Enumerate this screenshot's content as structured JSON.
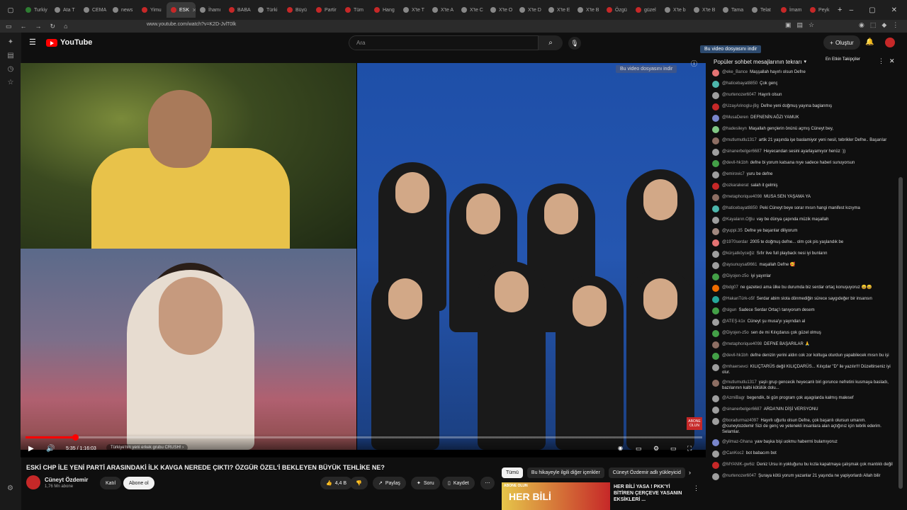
{
  "browser": {
    "tabs": [
      {
        "label": "Turkiy",
        "color": "#2e7d32"
      },
      {
        "label": "Ata T",
        "color": "#888"
      },
      {
        "label": "CEMA",
        "color": "#888"
      },
      {
        "label": "news",
        "color": "#888"
      },
      {
        "label": "Yimu",
        "color": "#c62828"
      },
      {
        "label": "ESK",
        "color": "#c62828",
        "active": true
      },
      {
        "label": "İhamı",
        "color": "#888"
      },
      {
        "label": "BABA",
        "color": "#c62828"
      },
      {
        "label": "Türki",
        "color": "#888"
      },
      {
        "label": "Büyü",
        "color": "#c62828"
      },
      {
        "label": "Partir",
        "color": "#c62828"
      },
      {
        "label": "Tüm",
        "color": "#c62828"
      },
      {
        "label": "Hang",
        "color": "#c62828"
      },
      {
        "label": "X'te T",
        "color": "#888"
      },
      {
        "label": "X'te A",
        "color": "#888"
      },
      {
        "label": "X'te C",
        "color": "#888"
      },
      {
        "label": "X'te O",
        "color": "#888"
      },
      {
        "label": "X'te D",
        "color": "#888"
      },
      {
        "label": "X'te E",
        "color": "#888"
      },
      {
        "label": "X'te B",
        "color": "#888"
      },
      {
        "label": "Özgü",
        "color": "#c62828"
      },
      {
        "label": "güzel",
        "color": "#c62828"
      },
      {
        "label": "X'te b",
        "color": "#888"
      },
      {
        "label": "X'te B",
        "color": "#888"
      },
      {
        "label": "Tama",
        "color": "#888"
      },
      {
        "label": "Telat",
        "color": "#888"
      },
      {
        "label": "İmam",
        "color": "#c62828"
      },
      {
        "label": "Peyk",
        "color": "#c62828"
      }
    ],
    "url": "www.youtube.com/watch?v=K2D-JvlT0lk"
  },
  "youtube": {
    "logo": "YouTube",
    "search_placeholder": "Ara",
    "create_label": "Oluştur"
  },
  "player": {
    "time": "5:35 / 1:16:03",
    "chapter": "Türkiye'nin yeni erkek grubu CRUSH! ›",
    "progress": 0.073,
    "dossier": "Bu video dosyasını indir",
    "abone_badge": "ABONE OLUN"
  },
  "video": {
    "title": "ESKİ CHP İLE YENİ PARTİ ARASINDAKİ İLK KAVGA NEREDE ÇIKTI? ÖZGÜR ÖZEL'İ BEKLEYEN BÜYÜK TEHLİKE NE?",
    "channel": "Cüneyt Özdemir",
    "subs": "1,76 Mn abone",
    "join": "Katıl",
    "subscribe": "Abone ol",
    "likes": "4,4 B",
    "share": "Paylaş",
    "ask": "Soru",
    "save": "Kaydet"
  },
  "chat": {
    "banner": "Bu video dosyasını indir",
    "header": "Popüler sohbet mesajlarının tekrarı",
    "top_fans": "En Etkin Takipçiler",
    "messages": [
      {
        "author": "@eke_Bance",
        "text": "Maşşallah hayırlı olsun Defne",
        "color": "#e57373"
      },
      {
        "author": "@haticebayat8850",
        "text": "Çok genç",
        "color": "#4db6ac"
      },
      {
        "author": "@nurtenozer6047",
        "text": "Hayırlı olsun",
        "color": "#9e9e9e"
      },
      {
        "author": "@UzayArinoglu-j9g",
        "text": "Defne yeni doğmuş yayına baglanmış",
        "color": "#c62828"
      },
      {
        "author": "@MusaDeren",
        "text": "DEFNENİN AĞZI YAMUK",
        "color": "#7986cb"
      },
      {
        "author": "@hadesileyn",
        "text": "Maşallah gençlerin önünü açmış Cüneyt bey,",
        "color": "#81c784"
      },
      {
        "author": "@mutlumutlu1317",
        "text": "artik 21 yaşında işe baslamiyor yeni nesil, tebrikler Defne.. Başarılar",
        "color": "#8d6e63"
      },
      {
        "author": "@sinanerbelger6687",
        "text": "Heyecandan sesini ayarlayamıyor henüz :))",
        "color": "#9e9e9e"
      },
      {
        "author": "@devil-hk1bh",
        "text": "defne bi yorum katsana nıye sadece haberi sunuyorsun",
        "color": "#43a047"
      },
      {
        "author": "@emirovic7",
        "text": "yuru be defne",
        "color": "#9e9e9e"
      },
      {
        "author": "@ozkarakerat",
        "text": "salah it gelmiş",
        "color": "#c62828"
      },
      {
        "author": "@metaphorique4098",
        "text": "MUSA SEN YAŞAMA YA",
        "color": "#8d6e63"
      },
      {
        "author": "@haticebayat8850",
        "text": "Peki Cüneyt beye sorar mısın hangi manifest kızıyma",
        "color": "#4db6ac"
      },
      {
        "author": "@Kayaların.Oğlu",
        "text": "vay be dünya çapında müzik maşallah",
        "color": "#9e9e9e"
      },
      {
        "author": "@yuppi.35",
        "text": "Defne ye başarılar diliyorum",
        "color": "#a1887f"
      },
      {
        "author": "@1970serdar",
        "text": "2005 te doğmuş defne... olm çok pis yaşlandık be",
        "color": "#e57373"
      },
      {
        "author": "@kürşatköyceğiz",
        "text": "Sıfır live full playback nesi iyi bunların",
        "color": "#9e9e9e"
      },
      {
        "author": "@aysunuysal9661",
        "text": "maşallah Defne 🥰",
        "color": "#9e9e9e"
      },
      {
        "author": "@Diyojen-z5o",
        "text": "iyi yayınlar",
        "color": "#43a047"
      },
      {
        "author": "@bdg07",
        "text": "ne gazeteci ama ülke bu durumda biz serdar ortaç konuşuyoruz 😄😄",
        "color": "#ef6c00"
      },
      {
        "author": "@HakanTürk-o5f",
        "text": "Serdar abim slota dönmediğin sürece saygıdeğer bir insansın",
        "color": "#26a69a"
      },
      {
        "author": "@slgun",
        "text": "Sadece Serdar Ortaç'ı tanıyorum desem",
        "color": "#43a047"
      },
      {
        "author": "@ATEŞ-k1x",
        "text": "Cüneyt şu musa'yı yayından al",
        "color": "#9e9e9e"
      },
      {
        "author": "@Diyojen-z5o",
        "text": "sen de mi Kılıçdarus çok güzel olmuş",
        "color": "#43a047"
      },
      {
        "author": "@metaphorique4098",
        "text": "DEFNE BAŞARILAR 🙏",
        "color": "#8d6e63"
      },
      {
        "author": "@devil-hk1bh",
        "text": "defne denizin yerini aldın cok zor koltuga oturdun yapabilecek mısın bu işi",
        "color": "#43a047"
      },
      {
        "author": "@mhaersevci",
        "text": "KILIÇTARÜS değil KILIÇDARÜS... Kılıçdar \"D\" ile yazılır!!! Düzeltirseniz iyi olur.",
        "color": "#9e9e9e"
      },
      {
        "author": "@mutlumutlu1317",
        "text": "yaşlı grup gencecik heyecanlı biri gorunce nefretini kusmaya basladı, bazılarının kalbi kötülük dolu...",
        "color": "#8d6e63"
      },
      {
        "author": "@AzmiBagr",
        "text": "begendik, bi gün program çok aşagılarda kalmış malesef",
        "color": "#9e9e9e"
      },
      {
        "author": "@sinanerbelger6687",
        "text": "ARDA'NIN DİŞİ VERSYONU",
        "color": "#9e9e9e"
      },
      {
        "author": "@boradurmaz4097",
        "text": "Hayırlı uğurlu olsun Defne, çok başarılı olursun umarım. @cuneytozdemir Sizi de genç ve yetenekli insanlara alan açtığınız için tebrik ederim. Selamlar.",
        "color": "#9e9e9e"
      },
      {
        "author": "@yilmaz-Ghana",
        "text": "yaw başka bişi uokmu haberrni bulamıyoruz",
        "color": "#7986cb"
      },
      {
        "author": "@CanKoc2",
        "text": "bot babacım bot",
        "color": "#9e9e9e"
      },
      {
        "author": "@MYANIK-gw6iz",
        "text": "Deniz Ursu in yokluğunu bu kızla kapatmaya çalışmak çok mantıklı değil",
        "color": "#c62828"
      },
      {
        "author": "@nurtenozer6047",
        "text": "Şuraya kötü yorum yazanlar 21 yaşında ne yapiyorlardı Allah bilir",
        "color": "#9e9e9e"
      }
    ]
  },
  "related": {
    "chips": [
      "Tümü",
      "Bu hikayeyle ilgili diğer içerikler",
      "Cüneyt Özdemir adlı yükleyicid"
    ],
    "thumb_text": "HER BİLİ",
    "thumb_tag": "ABONE OLUN",
    "title": "HER BİLİ YASA ! PKK'Yİ BİTİREN ÇERÇEVE YASANIN EKSİKLERİ ..."
  }
}
